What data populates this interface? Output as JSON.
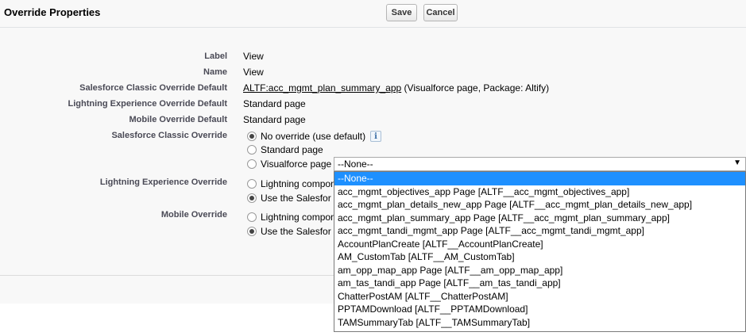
{
  "header": {
    "title": "Override Properties",
    "save_label": "Save",
    "cancel_label": "Cancel"
  },
  "fields": {
    "label": {
      "label": "Label",
      "value": "View"
    },
    "name": {
      "label": "Name",
      "value": "View"
    },
    "classic_default": {
      "label": "Salesforce Classic Override Default",
      "link": "ALTF:acc_mgmt_plan_summary_app",
      "suffix": " (Visualforce page, Package: Altify)"
    },
    "lightning_default": {
      "label": "Lightning Experience Override Default",
      "value": "Standard page"
    },
    "mobile_default": {
      "label": "Mobile Override Default",
      "value": "Standard page"
    }
  },
  "classic_override": {
    "label": "Salesforce Classic Override",
    "options": [
      {
        "label": "No override (use default)",
        "checked": true
      },
      {
        "label": "Standard page",
        "checked": false
      },
      {
        "label": "Visualforce page",
        "checked": false
      }
    ],
    "info_icon": "info-icon"
  },
  "lightning_override": {
    "label": "Lightning Experience Override",
    "options": [
      {
        "label": "Lightning compon",
        "checked": false
      },
      {
        "label": "Use the Salesfor",
        "checked": true
      }
    ]
  },
  "mobile_override": {
    "label": "Mobile Override",
    "options": [
      {
        "label": "Lightning compon",
        "checked": false
      },
      {
        "label": "Use the Salesfor",
        "checked": true
      }
    ]
  },
  "visualforce_select": {
    "selected": "--None--",
    "arrow": "▼",
    "options": [
      "--None--",
      "acc_mgmt_objectives_app Page [ALTF__acc_mgmt_objectives_app]",
      "acc_mgmt_plan_details_new_app Page [ALTF__acc_mgmt_plan_details_new_app]",
      "acc_mgmt_plan_summary_app Page [ALTF__acc_mgmt_plan_summary_app]",
      "acc_mgmt_tandi_mgmt_app Page [ALTF__acc_mgmt_tandi_mgmt_app]",
      "AccountPlanCreate [ALTF__AccountPlanCreate]",
      "AM_CustomTab [ALTF__AM_CustomTab]",
      "am_opp_map_app Page [ALTF__am_opp_map_app]",
      "am_tas_tandi_app Page [ALTF__am_tas_tandi_app]",
      "ChatterPostAM [ALTF__ChatterPostAM]",
      "PPTAMDownload [ALTF__PPTAMDownload]",
      "TAMSummaryTab [ALTF__TAMSummaryTab]"
    ],
    "highlighted_index": 0
  },
  "colors": {
    "highlight": "#1e90ff",
    "label_text": "#4a4a56",
    "panel_bg": "#f8f8f8"
  }
}
